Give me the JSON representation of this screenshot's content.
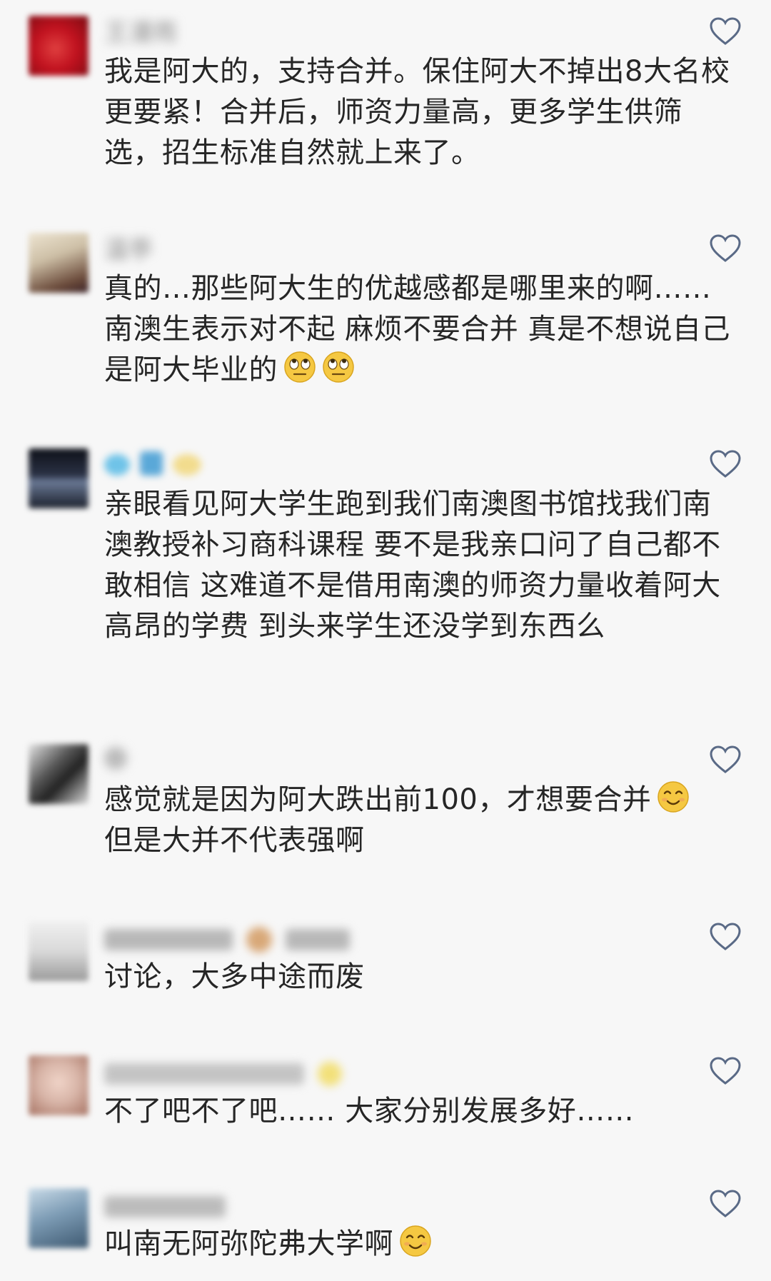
{
  "comments": [
    {
      "nickname": "王漫雨",
      "text": "我是阿大的，支持合并。保住阿大不掉出8大名校更要紧！合并后，师资力量高，更多学生供筛选，招生标准自然就上来了。",
      "emoji": [],
      "avatar_colors": [
        "#c1121f",
        "#7a0b12"
      ]
    },
    {
      "nickname": "温亭",
      "text": "真的…那些阿大生的优越感都是哪里来的啊……南澳生表示对不起 麻烦不要合并 真是不想说自己是阿大毕业的",
      "emoji": [
        "eye-roll-emoji",
        "eye-roll-emoji"
      ],
      "avatar_colors": [
        "#cdbfa6",
        "#6a4a3a"
      ]
    },
    {
      "nickname": "",
      "text": "亲眼看见阿大学生跑到我们南澳图书馆找我们南澳教授补习商科课程 要不是我亲口问了自己都不敢相信 这难道不是借用南澳的师资力量收着阿大高昂的学费 到头来学生还没学到东西么",
      "emoji": [],
      "avatar_colors": [
        "#2b3245",
        "#0d1018"
      ]
    },
    {
      "nickname": "",
      "text": "感觉就是因为阿大跌出前100，才想要合并",
      "text2": "但是大并不代表强啊",
      "emoji": [
        "smiling-emoji"
      ],
      "avatar_colors": [
        "#555555",
        "#e5e5e5"
      ]
    },
    {
      "nickname": "",
      "text": "讨论，大多中途而废",
      "emoji": [],
      "avatar_colors": [
        "#d9d9d9",
        "#9a9a9a"
      ]
    },
    {
      "nickname": "",
      "text": "不了吧不了吧…… 大家分别发展多好……",
      "emoji": [],
      "avatar_colors": [
        "#d8b5a8",
        "#a67262"
      ]
    },
    {
      "nickname": "",
      "text": "叫南无阿弥陀弗大学啊",
      "emoji": [
        "smiling-emoji"
      ],
      "avatar_colors": [
        "#7d9cb5",
        "#3d5870"
      ]
    }
  ]
}
